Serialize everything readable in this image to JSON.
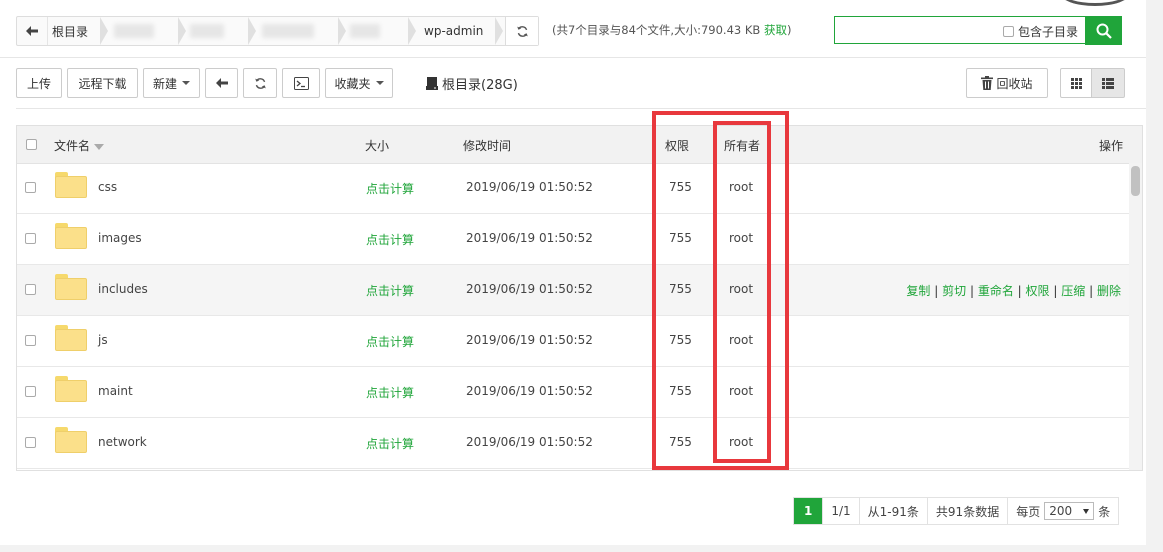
{
  "colors": {
    "accent": "#20a53a",
    "highlight": "#e8383d"
  },
  "path": {
    "root_label": "根目录",
    "current": "wp-admin",
    "info": "(共7个目录与84个文件,大小:790.43 KB",
    "get_link": "获取",
    "info_close": ")"
  },
  "search": {
    "subdir_label": "包含子目录",
    "value": ""
  },
  "toolbar": {
    "upload": "上传",
    "remote_download": "远程下载",
    "new": "新建",
    "favorites": "收藏夹",
    "disk_label": "根目录(28G)",
    "recycle": "回收站"
  },
  "table": {
    "headers": {
      "name": "文件名",
      "size": "大小",
      "mtime": "修改时间",
      "perm": "权限",
      "owner": "所有者",
      "ops": "操作"
    },
    "rows": [
      {
        "name": "css",
        "size": "点击计算",
        "mtime": "2019/06/19 01:50:52",
        "perm": "755",
        "owner": "root"
      },
      {
        "name": "images",
        "size": "点击计算",
        "mtime": "2019/06/19 01:50:52",
        "perm": "755",
        "owner": "root"
      },
      {
        "name": "includes",
        "size": "点击计算",
        "mtime": "2019/06/19 01:50:52",
        "perm": "755",
        "owner": "root"
      },
      {
        "name": "js",
        "size": "点击计算",
        "mtime": "2019/06/19 01:50:52",
        "perm": "755",
        "owner": "root"
      },
      {
        "name": "maint",
        "size": "点击计算",
        "mtime": "2019/06/19 01:50:52",
        "perm": "755",
        "owner": "root"
      },
      {
        "name": "network",
        "size": "点击计算",
        "mtime": "2019/06/19 01:50:52",
        "perm": "755",
        "owner": "root"
      }
    ],
    "row_actions": {
      "copy": "复制",
      "cut": "剪切",
      "rename": "重命名",
      "perm": "权限",
      "compress": "压缩",
      "delete": "删除",
      "sep": "|"
    }
  },
  "pagination": {
    "current_page": "1",
    "page_of": "1/1",
    "range": "从1-91条",
    "total": "共91条数据",
    "per_page_label": "每页",
    "per_page_value": "200",
    "unit": "条"
  }
}
